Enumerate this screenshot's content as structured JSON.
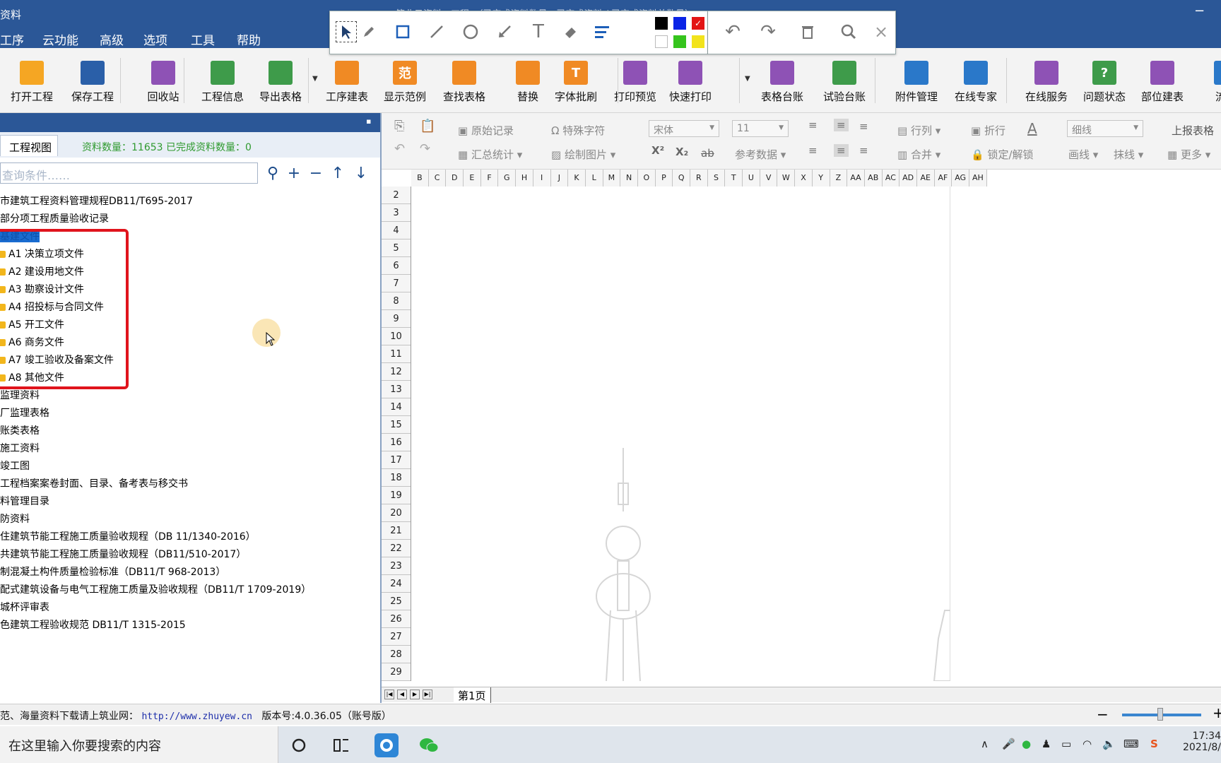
{
  "window": {
    "title": "资料",
    "title_hidden": "筑业云资料 - 工程：（已完成资料数量：已完成资料 / 已完成资料总数量）",
    "minimize": "−"
  },
  "menu": [
    "工序",
    "云功能",
    "高级",
    "选项",
    "工具",
    "帮助"
  ],
  "annotation_toolbar": {
    "colors": [
      "#000000",
      "#0a24e6",
      "#e31515",
      "#ffffff",
      "#35c41d",
      "#f2e31c"
    ],
    "tools": [
      "select-icon",
      "pen-icon",
      "rectangle-icon",
      "line-icon",
      "ellipse-icon",
      "arrow-icon",
      "text-icon",
      "eraser-icon",
      "line-style-icon",
      "undo-icon",
      "redo-icon",
      "delete-icon",
      "zoom-icon",
      "close-icon"
    ]
  },
  "toolbar": {
    "buttons": [
      {
        "label": "打开工程",
        "icon": "folder-open-icon",
        "color": "#f5a623"
      },
      {
        "label": "保存工程",
        "icon": "save-icon",
        "color": "#2a5fa8"
      },
      {
        "label": "回收站",
        "icon": "trash-icon",
        "color": "#8e52b5"
      },
      {
        "label": "工程信息",
        "icon": "info-icon",
        "color": "#3e9b4a"
      },
      {
        "label": "导出表格",
        "icon": "export-table-icon",
        "color": "#3e9b4a"
      },
      {
        "label": "工序建表",
        "icon": "layers-icon",
        "color": "#f08a24"
      },
      {
        "label": "显示范例",
        "icon": "example-icon",
        "color": "#f08a24",
        "glyph": "范"
      },
      {
        "label": "查找表格",
        "icon": "search-table-icon",
        "color": "#f08a24"
      },
      {
        "label": "替换",
        "icon": "replace-icon",
        "color": "#f08a24"
      },
      {
        "label": "字体批刷",
        "icon": "font-brush-icon",
        "color": "#f08a24",
        "glyph": "T"
      },
      {
        "label": "打印预览",
        "icon": "print-preview-icon",
        "color": "#8e52b5"
      },
      {
        "label": "快速打印",
        "icon": "printer-icon",
        "color": "#8e52b5"
      },
      {
        "label": "表格台账",
        "icon": "ledger-icon",
        "color": "#8e52b5"
      },
      {
        "label": "试验台账",
        "icon": "test-ledger-icon",
        "color": "#3e9b4a"
      },
      {
        "label": "附件管理",
        "icon": "paperclip-icon",
        "color": "#2a78c9"
      },
      {
        "label": "在线专家",
        "icon": "graduation-cap-icon",
        "color": "#2a78c9"
      },
      {
        "label": "在线服务",
        "icon": "headset-icon",
        "color": "#8e52b5"
      },
      {
        "label": "问题状态",
        "icon": "question-icon",
        "color": "#3e9b4a",
        "glyph": "?"
      },
      {
        "label": "部位建表",
        "icon": "grid-table-icon",
        "color": "#8e52b5"
      },
      {
        "label": "流水",
        "icon": "flow-icon",
        "color": "#2a78c9"
      }
    ]
  },
  "left_panel": {
    "tab_label": "工程视图",
    "count_text": "资料数量：11653  已完成资料数量：0",
    "search_placeholder": "查询条件……",
    "tree": [
      "市建筑工程资料管理规程DB11/T695-2017",
      "部分项工程质量验收记录",
      "基建文件",
      "A1  决策立项文件",
      "A2  建设用地文件",
      "A3  勘察设计文件",
      "A4  招投标与合同文件",
      "A5  开工文件",
      "A6  商务文件",
      "A7  竣工验收及备案文件",
      "A8  其他文件",
      "监理资料",
      "厂监理表格",
      "账类表格",
      "施工资料",
      "竣工图",
      "工程档案案卷封面、目录、备考表与移交书",
      "料管理目录",
      "防资料",
      "住建筑节能工程施工质量验收规程（DB 11/1340-2016）",
      "共建筑节能工程施工质量验收规程（DB11/510-2017）",
      "制混凝土构件质量检验标准（DB11/T 968-2013）",
      "配式建筑设备与电气工程施工质量及验收规程（DB11/T 1709-2019）",
      "城杯评审表",
      "色建筑工程验收规范 DB11/T 1315-2015"
    ]
  },
  "right_toolbar": {
    "original_record": "原始记录",
    "summary": "汇总统计",
    "special_char": "特殊字符",
    "draw_image": "绘制图片",
    "font": "宋体",
    "size": "11",
    "ref_data": "参考数据",
    "row_col": "行列",
    "merge": "合并",
    "wrap": "折行",
    "lock": "锁定/解锁",
    "line_style": "细线",
    "draw_line": "画线",
    "erase_line": "抹线",
    "report": "上报表格",
    "more": "更多",
    "sup": "X²",
    "sub": "X₂",
    "strike": "ab"
  },
  "grid": {
    "columns": [
      "B",
      "C",
      "D",
      "E",
      "F",
      "G",
      "H",
      "I",
      "J",
      "K",
      "L",
      "M",
      "N",
      "O",
      "P",
      "Q",
      "R",
      "S",
      "T",
      "U",
      "V",
      "W",
      "X",
      "Y",
      "Z",
      "AA",
      "AB",
      "AC",
      "AD",
      "AE",
      "AF",
      "AG",
      "AH"
    ],
    "rows": [
      "2",
      "3",
      "4",
      "5",
      "6",
      "7",
      "8",
      "9",
      "10",
      "11",
      "12",
      "13",
      "14",
      "15",
      "16",
      "17",
      "18",
      "19",
      "20",
      "21",
      "22",
      "23",
      "24",
      "25",
      "26",
      "27",
      "28",
      "29"
    ],
    "sheet_tab": "第1页"
  },
  "status": {
    "text": "范、海量资料下载请上筑业网：",
    "url": "http://www.zhuyew.cn",
    "version": "版本号:4.0.36.05（账号版）"
  },
  "taskbar": {
    "search_text": "在这里输入你要搜索的内容",
    "time": "17:34",
    "date": "2021/8/"
  }
}
